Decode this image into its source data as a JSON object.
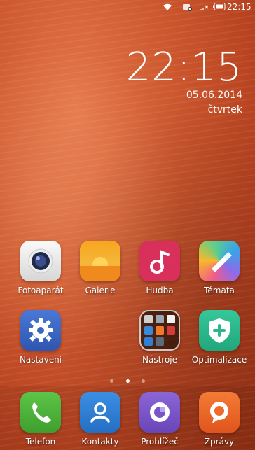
{
  "status": {
    "time": "22:15",
    "icons": [
      "wifi-icon",
      "notification-off-icon",
      "signal-icon",
      "battery-icon"
    ]
  },
  "lockclock": {
    "time": "22:15",
    "date": "05.06.2014",
    "day": "čtvrtek"
  },
  "apps": {
    "row1": [
      {
        "label": "Fotoaparát",
        "icon": "camera-icon"
      },
      {
        "label": "Galerie",
        "icon": "gallery-icon"
      },
      {
        "label": "Hudba",
        "icon": "music-icon"
      },
      {
        "label": "Témata",
        "icon": "themes-icon"
      }
    ],
    "row2": [
      {
        "label": "Nastavení",
        "icon": "settings-icon"
      },
      {
        "label": "Nástroje",
        "icon": "tools-folder-icon"
      },
      {
        "label": "Optimalizace",
        "icon": "security-icon"
      }
    ]
  },
  "pager": {
    "pages": 3,
    "active": 2
  },
  "dock": [
    {
      "label": "Telefon",
      "icon": "phone-icon"
    },
    {
      "label": "Kontakty",
      "icon": "contacts-icon"
    },
    {
      "label": "Prohlížeč",
      "icon": "browser-icon"
    },
    {
      "label": "Zprávy",
      "icon": "messages-icon"
    }
  ],
  "colors": {
    "camera": "#e6e6e6",
    "gallery": "#f3a227",
    "music": "#d8305a",
    "settings": "#3d66c2",
    "security": "#2bb68c",
    "phone": "#4cb33b",
    "contacts": "#2f7fd6",
    "browser": "#7a55c6",
    "messages": "#f06a2a"
  }
}
